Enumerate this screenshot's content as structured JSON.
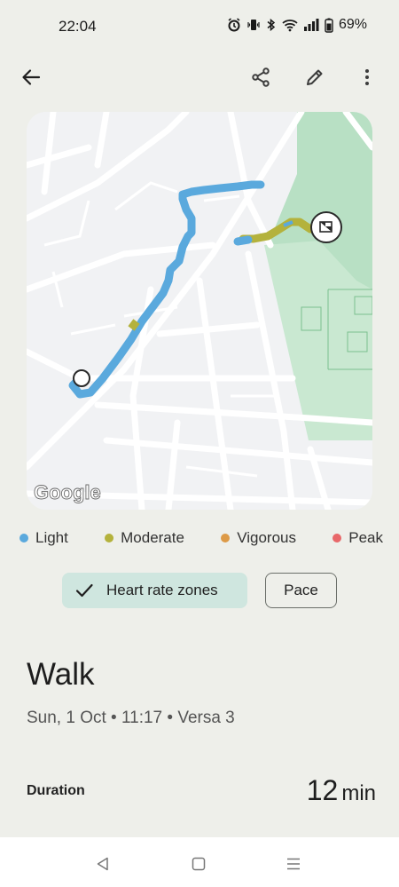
{
  "status": {
    "time": "22:04",
    "battery": "69%"
  },
  "legend": [
    {
      "label": "Light",
      "color": "#5aa9dd"
    },
    {
      "label": "Moderate",
      "color": "#b4b23c"
    },
    {
      "label": "Vigorous",
      "color": "#dd9a47"
    },
    {
      "label": "Peak",
      "color": "#e8686a"
    }
  ],
  "chips": {
    "heart_rate_zones": "Heart rate zones",
    "pace": "Pace"
  },
  "activity": {
    "title": "Walk",
    "subtitle": "Sun, 1 Oct • 11:17 • Versa 3"
  },
  "duration": {
    "label": "Duration",
    "value": "12",
    "unit": "min"
  },
  "map": {
    "attribution": "Google"
  }
}
